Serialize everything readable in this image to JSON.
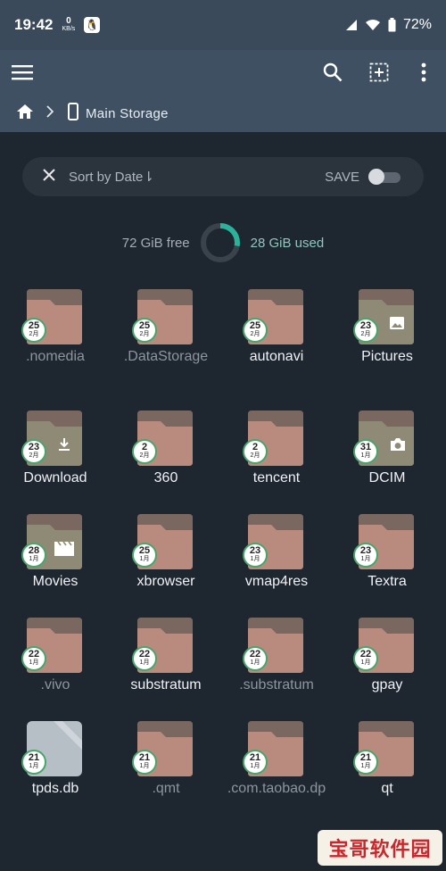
{
  "status": {
    "time": "19:42",
    "net_speed_value": "0",
    "net_speed_unit": "KB/s",
    "battery": "72%"
  },
  "toolbar": {
    "menu_icon": "hamburger-menu-icon",
    "search_icon": "search-icon",
    "select_icon": "select-all-icon",
    "more_icon": "more-vert-icon"
  },
  "breadcrumb": {
    "home_icon": "home-icon",
    "storage_label": "Main Storage"
  },
  "sort_bar": {
    "label": "Sort by Date",
    "arrow": "⇂",
    "save_label": "SAVE"
  },
  "storage": {
    "free": "72 GiB free",
    "used": "28 GiB used",
    "used_fraction": 0.28,
    "accent": "#2ab29a"
  },
  "folders": [
    {
      "name": ".nomedia",
      "day": "25",
      "month": "2月",
      "hidden": true,
      "overlay": ""
    },
    {
      "name": ".DataStorage",
      "day": "25",
      "month": "2月",
      "hidden": true,
      "overlay": ""
    },
    {
      "name": "autonavi",
      "day": "25",
      "month": "2月",
      "hidden": false,
      "overlay": ""
    },
    {
      "name": "Pictures",
      "day": "23",
      "month": "2月",
      "hidden": false,
      "overlay": "image-icon"
    },
    {
      "name": "Download",
      "day": "23",
      "month": "2月",
      "hidden": false,
      "overlay": "download-icon"
    },
    {
      "name": "360",
      "day": "2",
      "month": "2月",
      "hidden": false,
      "overlay": ""
    },
    {
      "name": "tencent",
      "day": "2",
      "month": "2月",
      "hidden": false,
      "overlay": ""
    },
    {
      "name": "DCIM",
      "day": "31",
      "month": "1月",
      "hidden": false,
      "overlay": "camera-icon"
    },
    {
      "name": "Movies",
      "day": "28",
      "month": "1月",
      "hidden": false,
      "overlay": "movie-icon"
    },
    {
      "name": "xbrowser",
      "day": "25",
      "month": "1月",
      "hidden": false,
      "overlay": ""
    },
    {
      "name": "vmap4res",
      "day": "23",
      "month": "1月",
      "hidden": false,
      "overlay": ""
    },
    {
      "name": "Textra",
      "day": "23",
      "month": "1月",
      "hidden": false,
      "overlay": ""
    },
    {
      "name": ".vivo",
      "day": "22",
      "month": "1月",
      "hidden": true,
      "overlay": ""
    },
    {
      "name": "substratum",
      "day": "22",
      "month": "1月",
      "hidden": false,
      "overlay": ""
    },
    {
      "name": ".substratum",
      "day": "22",
      "month": "1月",
      "hidden": true,
      "overlay": ""
    },
    {
      "name": "gpay",
      "day": "22",
      "month": "1月",
      "hidden": false,
      "overlay": ""
    },
    {
      "name": "tpds.db",
      "day": "21",
      "month": "1月",
      "hidden": false,
      "overlay": "",
      "file": true
    },
    {
      "name": ".qmt",
      "day": "21",
      "month": "1月",
      "hidden": true,
      "overlay": ""
    },
    {
      "name": ".com.taobao.dp",
      "day": "21",
      "month": "1月",
      "hidden": true,
      "overlay": ""
    },
    {
      "name": "qt",
      "day": "21",
      "month": "1月",
      "hidden": false,
      "overlay": ""
    }
  ],
  "watermark": "宝哥软件园",
  "colors": {
    "folder_body": "#b98b7f",
    "folder_back": "#7a6860",
    "media_folder": "#8e8a76"
  }
}
